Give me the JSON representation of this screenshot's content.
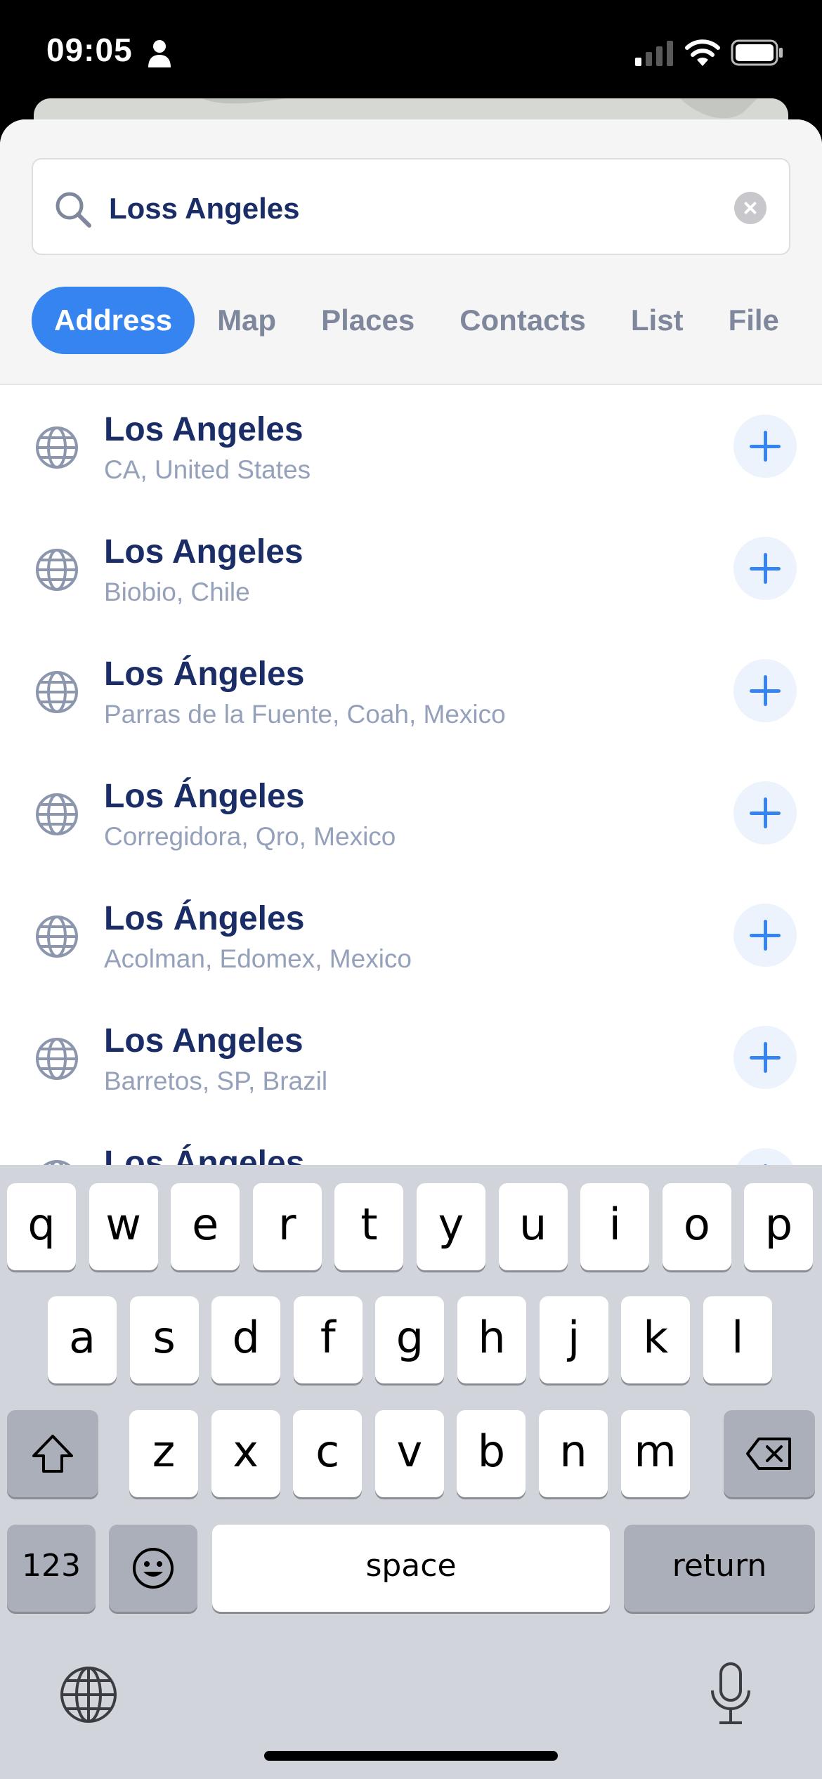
{
  "status_bar": {
    "time": "09:05"
  },
  "search": {
    "value": "Loss Angeles"
  },
  "tabs": [
    {
      "label": "Address",
      "active": true
    },
    {
      "label": "Map",
      "active": false
    },
    {
      "label": "Places",
      "active": false
    },
    {
      "label": "Contacts",
      "active": false
    },
    {
      "label": "List",
      "active": false
    },
    {
      "label": "File",
      "active": false
    }
  ],
  "results": [
    {
      "title": "Los Angeles",
      "subtitle": "CA, United States"
    },
    {
      "title": "Los Angeles",
      "subtitle": "Biobio, Chile"
    },
    {
      "title": "Los Ángeles",
      "subtitle": "Parras de la Fuente, Coah, Mexico"
    },
    {
      "title": "Los Ángeles",
      "subtitle": "Corregidora, Qro, Mexico"
    },
    {
      "title": "Los Ángeles",
      "subtitle": "Acolman, Edomex, Mexico"
    },
    {
      "title": "Los Angeles",
      "subtitle": "Barretos, SP, Brazil"
    },
    {
      "title": "Los Ángeles",
      "subtitle": ""
    }
  ],
  "keyboard": {
    "row1": [
      "q",
      "w",
      "e",
      "r",
      "t",
      "y",
      "u",
      "i",
      "o",
      "p"
    ],
    "row2": [
      "a",
      "s",
      "d",
      "f",
      "g",
      "h",
      "j",
      "k",
      "l"
    ],
    "row3": [
      "z",
      "x",
      "c",
      "v",
      "b",
      "n",
      "m"
    ],
    "numbers_label": "123",
    "space_label": "space",
    "return_label": "return"
  },
  "colors": {
    "accent": "#3584f0",
    "title": "#1b2d66",
    "subtitle": "#95a1ba",
    "keyboard_bg": "#d1d4db"
  }
}
